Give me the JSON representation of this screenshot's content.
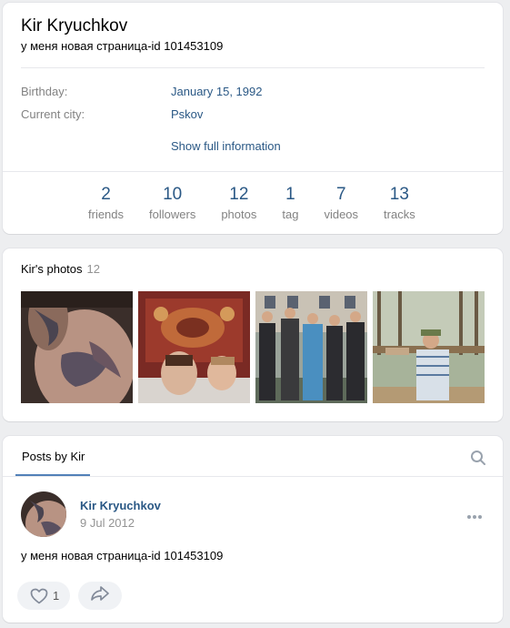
{
  "profile": {
    "name": "Kir Kryuchkov",
    "status": "у меня новая страница-id 101453109",
    "info": [
      {
        "label": "Birthday:",
        "value": "January 15, 1992"
      },
      {
        "label": "Current city:",
        "value": "Pskov"
      }
    ],
    "show_full": "Show full information",
    "counters": [
      {
        "num": "2",
        "label": "friends"
      },
      {
        "num": "10",
        "label": "followers"
      },
      {
        "num": "12",
        "label": "photos"
      },
      {
        "num": "1",
        "label": "tag"
      },
      {
        "num": "7",
        "label": "videos"
      },
      {
        "num": "13",
        "label": "tracks"
      }
    ]
  },
  "photos": {
    "title": "Kir's photos",
    "count": "12"
  },
  "posts": {
    "tab_label": "Posts by Kir",
    "post": {
      "author": "Kir Kryuchkov",
      "date": "9 Jul 2012",
      "text": "у меня новая страница-id 101453109",
      "likes": "1"
    }
  },
  "colors": {
    "link": "#2a5885",
    "accent": "#5181b8",
    "background": "#edeef0"
  }
}
